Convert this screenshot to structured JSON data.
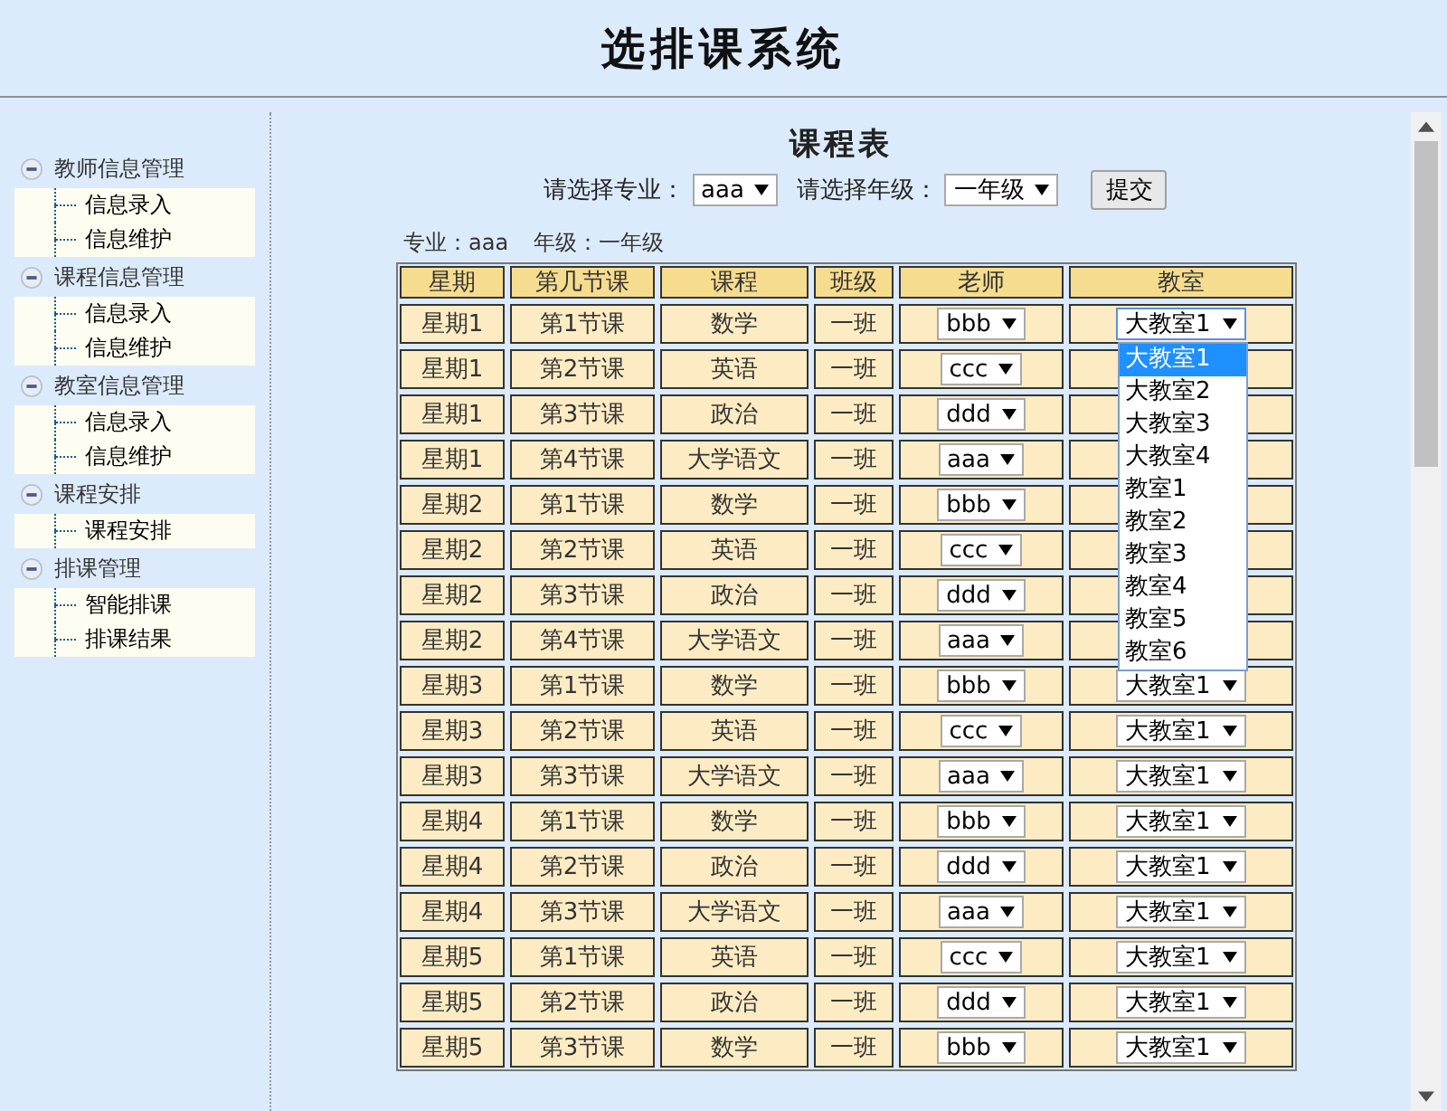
{
  "header": {
    "title": "选排课系统"
  },
  "sidebar": {
    "groups": [
      {
        "label": "教师信息管理",
        "expanded": true,
        "items": [
          {
            "label": "信息录入"
          },
          {
            "label": "信息维护"
          }
        ]
      },
      {
        "label": "课程信息管理",
        "expanded": true,
        "items": [
          {
            "label": "信息录入"
          },
          {
            "label": "信息维护"
          }
        ]
      },
      {
        "label": "教室信息管理",
        "expanded": true,
        "items": [
          {
            "label": "信息录入"
          },
          {
            "label": "信息维护"
          }
        ]
      },
      {
        "label": "课程安排",
        "expanded": true,
        "items": [
          {
            "label": "课程安排"
          }
        ]
      },
      {
        "label": "排课管理",
        "expanded": true,
        "items": [
          {
            "label": "智能排课"
          },
          {
            "label": "排课结果"
          }
        ]
      }
    ]
  },
  "main": {
    "title": "课程表",
    "filters": [
      {
        "label": "请选择专业：",
        "value": "aaa"
      },
      {
        "label": "请选择年级：",
        "value": "一年级"
      }
    ],
    "submit": "提交",
    "summary": [
      "专业：aaa",
      "年级：一年级"
    ],
    "table": {
      "columns": [
        "星期",
        "第几节课",
        "课程",
        "班级",
        "老师",
        "教室"
      ],
      "rows": [
        {
          "day": "星期1",
          "period": "第1节课",
          "course": "数学",
          "class": "一班",
          "teacher": "bbb",
          "room": "大教室1",
          "open": true
        },
        {
          "day": "星期1",
          "period": "第2节课",
          "course": "英语",
          "class": "一班",
          "teacher": "ccc"
        },
        {
          "day": "星期1",
          "period": "第3节课",
          "course": "政治",
          "class": "一班",
          "teacher": "ddd"
        },
        {
          "day": "星期1",
          "period": "第4节课",
          "course": "大学语文",
          "class": "一班",
          "teacher": "aaa"
        },
        {
          "day": "星期2",
          "period": "第1节课",
          "course": "数学",
          "class": "一班",
          "teacher": "bbb"
        },
        {
          "day": "星期2",
          "period": "第2节课",
          "course": "英语",
          "class": "一班",
          "teacher": "ccc"
        },
        {
          "day": "星期2",
          "period": "第3节课",
          "course": "政治",
          "class": "一班",
          "teacher": "ddd"
        },
        {
          "day": "星期2",
          "period": "第4节课",
          "course": "大学语文",
          "class": "一班",
          "teacher": "aaa"
        },
        {
          "day": "星期3",
          "period": "第1节课",
          "course": "数学",
          "class": "一班",
          "teacher": "bbb",
          "room": "大教室1",
          "open": false
        },
        {
          "day": "星期3",
          "period": "第2节课",
          "course": "英语",
          "class": "一班",
          "teacher": "ccc",
          "room": "大教室1",
          "open": false
        },
        {
          "day": "星期3",
          "period": "第3节课",
          "course": "大学语文",
          "class": "一班",
          "teacher": "aaa",
          "room": "大教室1",
          "open": false
        },
        {
          "day": "星期4",
          "period": "第1节课",
          "course": "数学",
          "class": "一班",
          "teacher": "bbb",
          "room": "大教室1",
          "open": false
        },
        {
          "day": "星期4",
          "period": "第2节课",
          "course": "政治",
          "class": "一班",
          "teacher": "ddd",
          "room": "大教室1",
          "open": false
        },
        {
          "day": "星期4",
          "period": "第3节课",
          "course": "大学语文",
          "class": "一班",
          "teacher": "aaa",
          "room": "大教室1",
          "open": false
        },
        {
          "day": "星期5",
          "period": "第1节课",
          "course": "英语",
          "class": "一班",
          "teacher": "ccc",
          "room": "大教室1",
          "open": false
        },
        {
          "day": "星期5",
          "period": "第2节课",
          "course": "政治",
          "class": "一班",
          "teacher": "ddd",
          "room": "大教室1",
          "open": false
        },
        {
          "day": "星期5",
          "period": "第3节课",
          "course": "数学",
          "class": "一班",
          "teacher": "bbb",
          "room": "大教室1",
          "open": false
        }
      ]
    },
    "room_dropdown": {
      "options": [
        {
          "label": "大教室1",
          "selected": true
        },
        {
          "label": "大教室2",
          "selected": false
        },
        {
          "label": "大教室3",
          "selected": false
        },
        {
          "label": "大教室4",
          "selected": false
        },
        {
          "label": "教室1",
          "selected": false
        },
        {
          "label": "教室2",
          "selected": false
        },
        {
          "label": "教室3",
          "selected": false
        },
        {
          "label": "教室4",
          "selected": false
        },
        {
          "label": "教室5",
          "selected": false
        },
        {
          "label": "教室6",
          "selected": false
        }
      ]
    }
  }
}
